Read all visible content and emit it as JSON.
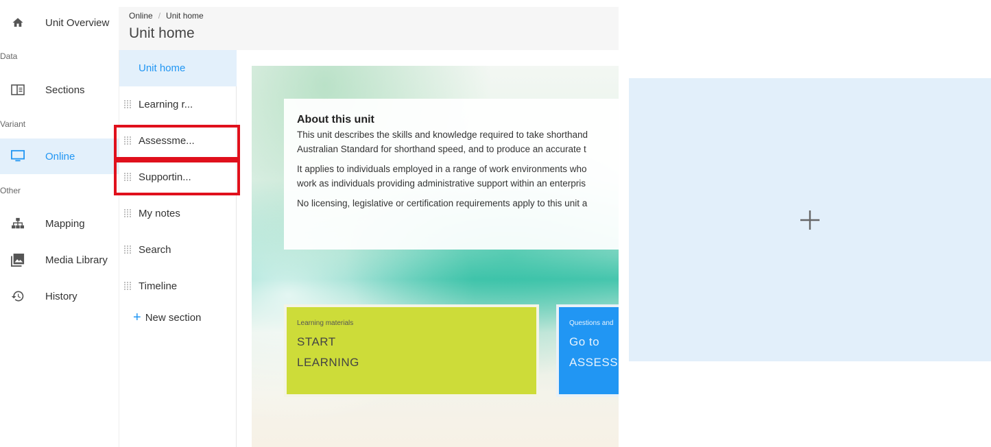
{
  "nav": {
    "unit_overview": "Unit Overview",
    "group_data": "Data",
    "sections": "Sections",
    "group_variant": "Variant",
    "online": "Online",
    "group_other": "Other",
    "mapping": "Mapping",
    "media_library": "Media Library",
    "history": "History"
  },
  "header": {
    "breadcrumb": [
      "Online",
      "Unit home"
    ],
    "breadcrumb_sep": "/",
    "title": "Unit home"
  },
  "sections": {
    "items": [
      {
        "label": "Unit home",
        "active": true
      },
      {
        "label": "Learning r..."
      },
      {
        "label": "Assessme..."
      },
      {
        "label": "Supportin..."
      },
      {
        "label": "My notes"
      },
      {
        "label": "Search"
      },
      {
        "label": "Timeline"
      }
    ],
    "new_section_label": "New section"
  },
  "content": {
    "about_title": "About this unit",
    "para1_line1": "This unit describes the skills and knowledge required to take shorthand",
    "para1_line2": "Australian Standard for shorthand speed, and to produce an accurate t",
    "para2_line1": "It applies to individuals employed in a range of work environments who",
    "para2_line2": "work as individuals providing administrative support within an enterpris",
    "para3_line1": "No licensing, legislative or certification requirements apply to this unit a",
    "tile_learning": {
      "caption": "Learning materials",
      "line1": "START",
      "line2": "LEARNING"
    },
    "tile_assess": {
      "caption": "Questions and",
      "line1": "Go to",
      "line2": "ASSESS"
    }
  },
  "colors": {
    "accent": "#2196f3",
    "active_bg": "#e3f0fb",
    "highlight": "#e0101c",
    "tile_learning": "#cddc39",
    "tile_assess": "#2196f3",
    "add_panel": "#e2effa"
  },
  "add_panel": {
    "icon": "plus-icon"
  }
}
